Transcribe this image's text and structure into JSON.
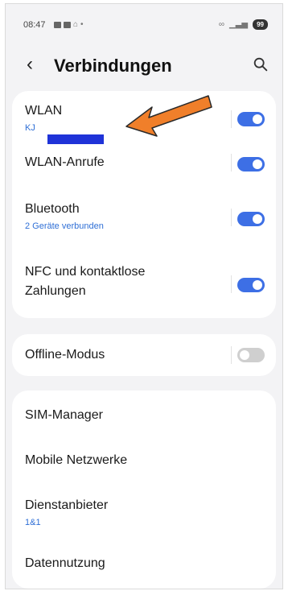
{
  "status_bar": {
    "time": "08:47",
    "battery": "99"
  },
  "header": {
    "title": "Verbindungen"
  },
  "rows": {
    "wlan": {
      "label": "WLAN",
      "subtitle": "KJ",
      "on": true
    },
    "wlan_calls": {
      "label": "WLAN-Anrufe",
      "on": true
    },
    "bluetooth": {
      "label": "Bluetooth",
      "subtitle": "2 Geräte verbunden",
      "on": true
    },
    "nfc": {
      "label_line1": "NFC und kontaktlose",
      "label_line2": "Zahlungen",
      "on": true
    },
    "offline": {
      "label": "Offline-Modus",
      "on": false
    },
    "sim": {
      "label": "SIM-Manager"
    },
    "mobile": {
      "label": "Mobile Netzwerke"
    },
    "provider": {
      "label": "Dienstanbieter",
      "subtitle": "1&1"
    },
    "data": {
      "label": "Datennutzung"
    }
  },
  "colors": {
    "toggle_on": "#3d6fe5",
    "toggle_off": "#cfcfcf",
    "accent_text": "#2f6fd6",
    "annotation_arrow": "#f07f2a",
    "redaction": "#1f33d8"
  },
  "icons": [
    "back-chevron-icon",
    "search-icon",
    "arrow-annotation-icon"
  ]
}
